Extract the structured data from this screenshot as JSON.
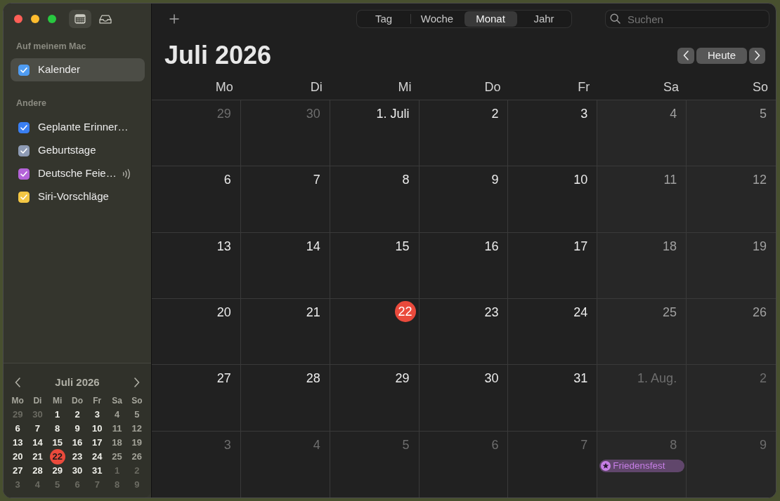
{
  "window": {
    "toolbar_buttons": [
      {
        "kind": "calendars",
        "selected": true
      },
      {
        "kind": "inbox",
        "selected": false
      }
    ]
  },
  "sidebar": {
    "groups": [
      {
        "heading": "Auf meinem Mac",
        "items": [
          {
            "label": "Kalender",
            "checked": true,
            "color": "#4f9cf2",
            "selected": true,
            "subscribed": false
          }
        ]
      },
      {
        "heading": "Andere",
        "items": [
          {
            "label": "Geplante Erinner…",
            "checked": true,
            "color": "#3a7ff2",
            "selected": false,
            "subscribed": false
          },
          {
            "label": "Geburtstage",
            "checked": true,
            "color": "#8e9bb4",
            "selected": false,
            "subscribed": false
          },
          {
            "label": "Deutsche Feie…",
            "checked": true,
            "color": "#b463d8",
            "selected": false,
            "subscribed": true
          },
          {
            "label": "Siri-Vorschläge",
            "checked": true,
            "color": "#f4c744",
            "selected": false,
            "subscribed": false
          }
        ]
      }
    ]
  },
  "mini_calendar": {
    "title": "Juli 2026",
    "weekdays": [
      "Mo",
      "Di",
      "Mi",
      "Do",
      "Fr",
      "Sa",
      "So"
    ],
    "days": [
      {
        "label": "29",
        "in_month": false,
        "today": false
      },
      {
        "label": "30",
        "in_month": false,
        "today": false
      },
      {
        "label": "1",
        "in_month": true,
        "today": false
      },
      {
        "label": "2",
        "in_month": true,
        "today": false
      },
      {
        "label": "3",
        "in_month": true,
        "today": false
      },
      {
        "label": "4",
        "in_month": true,
        "today": false
      },
      {
        "label": "5",
        "in_month": true,
        "today": false
      },
      {
        "label": "6",
        "in_month": true,
        "today": false
      },
      {
        "label": "7",
        "in_month": true,
        "today": false
      },
      {
        "label": "8",
        "in_month": true,
        "today": false
      },
      {
        "label": "9",
        "in_month": true,
        "today": false
      },
      {
        "label": "10",
        "in_month": true,
        "today": false
      },
      {
        "label": "11",
        "in_month": true,
        "today": false
      },
      {
        "label": "12",
        "in_month": true,
        "today": false
      },
      {
        "label": "13",
        "in_month": true,
        "today": false
      },
      {
        "label": "14",
        "in_month": true,
        "today": false
      },
      {
        "label": "15",
        "in_month": true,
        "today": false
      },
      {
        "label": "16",
        "in_month": true,
        "today": false
      },
      {
        "label": "17",
        "in_month": true,
        "today": false
      },
      {
        "label": "18",
        "in_month": true,
        "today": false
      },
      {
        "label": "19",
        "in_month": true,
        "today": false
      },
      {
        "label": "20",
        "in_month": true,
        "today": false
      },
      {
        "label": "21",
        "in_month": true,
        "today": false
      },
      {
        "label": "22",
        "in_month": true,
        "today": true
      },
      {
        "label": "23",
        "in_month": true,
        "today": false
      },
      {
        "label": "24",
        "in_month": true,
        "today": false
      },
      {
        "label": "25",
        "in_month": true,
        "today": false
      },
      {
        "label": "26",
        "in_month": true,
        "today": false
      },
      {
        "label": "27",
        "in_month": true,
        "today": false
      },
      {
        "label": "28",
        "in_month": true,
        "today": false
      },
      {
        "label": "29",
        "in_month": true,
        "today": false
      },
      {
        "label": "30",
        "in_month": true,
        "today": false
      },
      {
        "label": "31",
        "in_month": true,
        "today": false
      },
      {
        "label": "1",
        "in_month": false,
        "today": false
      },
      {
        "label": "2",
        "in_month": false,
        "today": false
      },
      {
        "label": "3",
        "in_month": false,
        "today": false
      },
      {
        "label": "4",
        "in_month": false,
        "today": false
      },
      {
        "label": "5",
        "in_month": false,
        "today": false
      },
      {
        "label": "6",
        "in_month": false,
        "today": false
      },
      {
        "label": "7",
        "in_month": false,
        "today": false
      },
      {
        "label": "8",
        "in_month": false,
        "today": false
      },
      {
        "label": "9",
        "in_month": false,
        "today": false
      }
    ]
  },
  "toolbar": {
    "view_tabs": [
      {
        "label": "Tag",
        "selected": false
      },
      {
        "label": "Woche",
        "selected": false
      },
      {
        "label": "Monat",
        "selected": true
      },
      {
        "label": "Jahr",
        "selected": false
      }
    ],
    "search": {
      "placeholder": "Suchen"
    }
  },
  "header": {
    "title": "Juli 2026",
    "today_button": "Heute"
  },
  "calendar": {
    "weekdays": [
      "Mo",
      "Di",
      "Mi",
      "Do",
      "Fr",
      "Sa",
      "So"
    ],
    "days": [
      {
        "label": "29",
        "in_month": false,
        "today": false
      },
      {
        "label": "30",
        "in_month": false,
        "today": false
      },
      {
        "label": "1. Juli",
        "in_month": true,
        "today": false
      },
      {
        "label": "2",
        "in_month": true,
        "today": false
      },
      {
        "label": "3",
        "in_month": true,
        "today": false
      },
      {
        "label": "4",
        "in_month": true,
        "today": false
      },
      {
        "label": "5",
        "in_month": true,
        "today": false
      },
      {
        "label": "6",
        "in_month": true,
        "today": false
      },
      {
        "label": "7",
        "in_month": true,
        "today": false
      },
      {
        "label": "8",
        "in_month": true,
        "today": false
      },
      {
        "label": "9",
        "in_month": true,
        "today": false
      },
      {
        "label": "10",
        "in_month": true,
        "today": false
      },
      {
        "label": "11",
        "in_month": true,
        "today": false
      },
      {
        "label": "12",
        "in_month": true,
        "today": false
      },
      {
        "label": "13",
        "in_month": true,
        "today": false
      },
      {
        "label": "14",
        "in_month": true,
        "today": false
      },
      {
        "label": "15",
        "in_month": true,
        "today": false
      },
      {
        "label": "16",
        "in_month": true,
        "today": false
      },
      {
        "label": "17",
        "in_month": true,
        "today": false
      },
      {
        "label": "18",
        "in_month": true,
        "today": false
      },
      {
        "label": "19",
        "in_month": true,
        "today": false
      },
      {
        "label": "20",
        "in_month": true,
        "today": false
      },
      {
        "label": "21",
        "in_month": true,
        "today": false
      },
      {
        "label": "22",
        "in_month": true,
        "today": true
      },
      {
        "label": "23",
        "in_month": true,
        "today": false
      },
      {
        "label": "24",
        "in_month": true,
        "today": false
      },
      {
        "label": "25",
        "in_month": true,
        "today": false
      },
      {
        "label": "26",
        "in_month": true,
        "today": false
      },
      {
        "label": "27",
        "in_month": true,
        "today": false
      },
      {
        "label": "28",
        "in_month": true,
        "today": false
      },
      {
        "label": "29",
        "in_month": true,
        "today": false
      },
      {
        "label": "30",
        "in_month": true,
        "today": false
      },
      {
        "label": "31",
        "in_month": true,
        "today": false
      },
      {
        "label": "1. Aug.",
        "in_month": false,
        "today": false
      },
      {
        "label": "2",
        "in_month": false,
        "today": false
      },
      {
        "label": "3",
        "in_month": false,
        "today": false
      },
      {
        "label": "4",
        "in_month": false,
        "today": false
      },
      {
        "label": "5",
        "in_month": false,
        "today": false
      },
      {
        "label": "6",
        "in_month": false,
        "today": false
      },
      {
        "label": "7",
        "in_month": false,
        "today": false
      },
      {
        "label": "8",
        "in_month": false,
        "today": false,
        "events": [
          {
            "title": "Friedensfest",
            "color": "#c77fe6"
          }
        ]
      },
      {
        "label": "9",
        "in_month": false,
        "today": false
      }
    ]
  }
}
